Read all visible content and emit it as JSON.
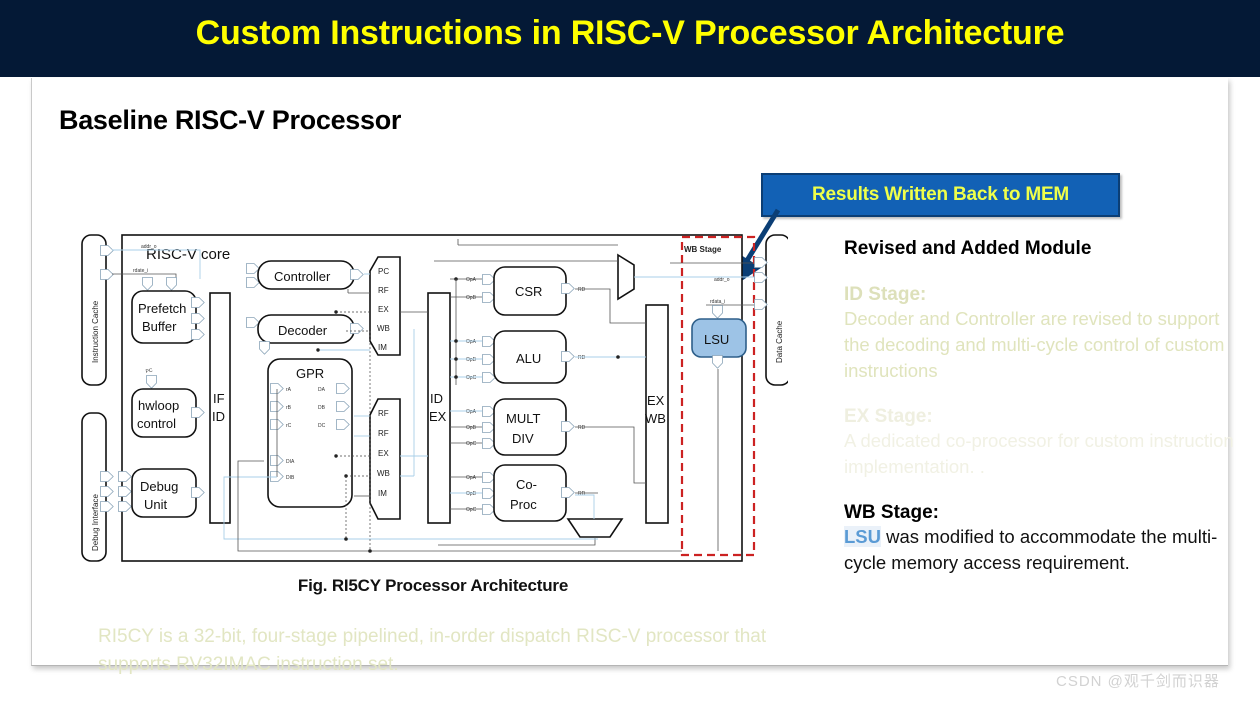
{
  "banner": {
    "title": "Custom Instructions in RISC-V Processor Architecture",
    "bg": "#041936",
    "fg": "#ffff00"
  },
  "slide": {
    "title": "Baseline RISC-V Processor",
    "figure_caption": "Fig. RI5CY Processor  Architecture",
    "figure_note": "RI5CY is a 32-bit, four-stage pipelined, in-order dispatch RISC-V processor that supports RV32IMAC instruction set."
  },
  "callout": {
    "label": "Results Written Back to MEM",
    "bg": "#1261b5",
    "fg": "#efff4a",
    "border": "#0b3e75"
  },
  "diagram": {
    "core_label": "RISC-V core",
    "left_caches": [
      {
        "name": "Instruction Cache"
      },
      {
        "name": "Debug Interface"
      }
    ],
    "right_cache": {
      "name": "Data Cache"
    },
    "bus_labels": {
      "addr_o": "addr_o",
      "rdata_i": "rdate_i",
      "wb_addr_o": "addr_o",
      "wb_rdata_i": "rdata_i"
    },
    "if_blocks": [
      {
        "name": "Prefetch Buffer",
        "line1": "Prefetch",
        "line2": "Buffer"
      },
      {
        "name": "hwloop control",
        "line1": "hwloop",
        "line2": "control",
        "port": "PC"
      },
      {
        "name": "Debug Unit",
        "line1": "Debug",
        "line2": "Unit"
      }
    ],
    "id_blocks": [
      {
        "name": "Controller",
        "label": "Controller"
      },
      {
        "name": "Decoder",
        "label": "Decoder"
      }
    ],
    "gpr": {
      "title": "GPR",
      "inputs": [
        "rA",
        "rB",
        "rC"
      ],
      "outputs": [
        "DA",
        "DB",
        "DC"
      ],
      "write_ports": [
        "DIA",
        "DIB"
      ]
    },
    "mux_top": {
      "inputs": [
        "PC",
        "RF",
        "EX",
        "WB",
        "IM"
      ]
    },
    "mux_bottom": {
      "inputs": [
        "RF",
        "RF",
        "EX",
        "WB",
        "IM"
      ]
    },
    "pipeline_registers": [
      {
        "name": "IF/ID",
        "line1": "IF",
        "line2": "ID"
      },
      {
        "name": "ID/EX",
        "line1": "ID",
        "line2": "EX"
      },
      {
        "name": "EX/WB",
        "line1": "EX",
        "line2": "WB"
      }
    ],
    "ex_units": [
      {
        "name": "CSR",
        "line1": "CSR",
        "line2": "",
        "ports": [
          "OpA",
          "OpB"
        ],
        "out": "RD"
      },
      {
        "name": "ALU",
        "line1": "ALU",
        "line2": "",
        "ports": [
          "OpA",
          "OpB",
          "OpC"
        ],
        "out": "RD"
      },
      {
        "name": "MULT DIV",
        "line1": "MULT",
        "line2": "DIV",
        "ports": [
          "OpA",
          "OpB",
          "OpC"
        ],
        "out": "RD"
      },
      {
        "name": "Co-Proc",
        "line1": "Co-",
        "line2": "Proc",
        "ports": [
          "OpA",
          "OpB",
          "OpC"
        ],
        "out": "RD"
      }
    ],
    "wb_stage": {
      "label": "WB Stage",
      "border_color": "#cc2222",
      "lsu": {
        "label": "LSU",
        "fill": "#9dc3e6"
      }
    }
  },
  "right_panel": {
    "heading": "Revised and Added Module",
    "sections": [
      {
        "title": "ID Stage:",
        "body": "Decoder and Controller are revised to support the decoding and multi-cycle control of custom instructions",
        "state": "faded"
      },
      {
        "title": "EX Stage:",
        "body": "A dedicated co-processor for custom instruction implementation. .",
        "state": "faded-more"
      },
      {
        "title": "WB Stage:",
        "body_prefix": "LSU",
        "body": " was modified to accommodate the multi-cycle memory access requirement.",
        "state": "visible"
      }
    ]
  },
  "watermark": {
    "text": "CSDN @观千剑而识器"
  }
}
